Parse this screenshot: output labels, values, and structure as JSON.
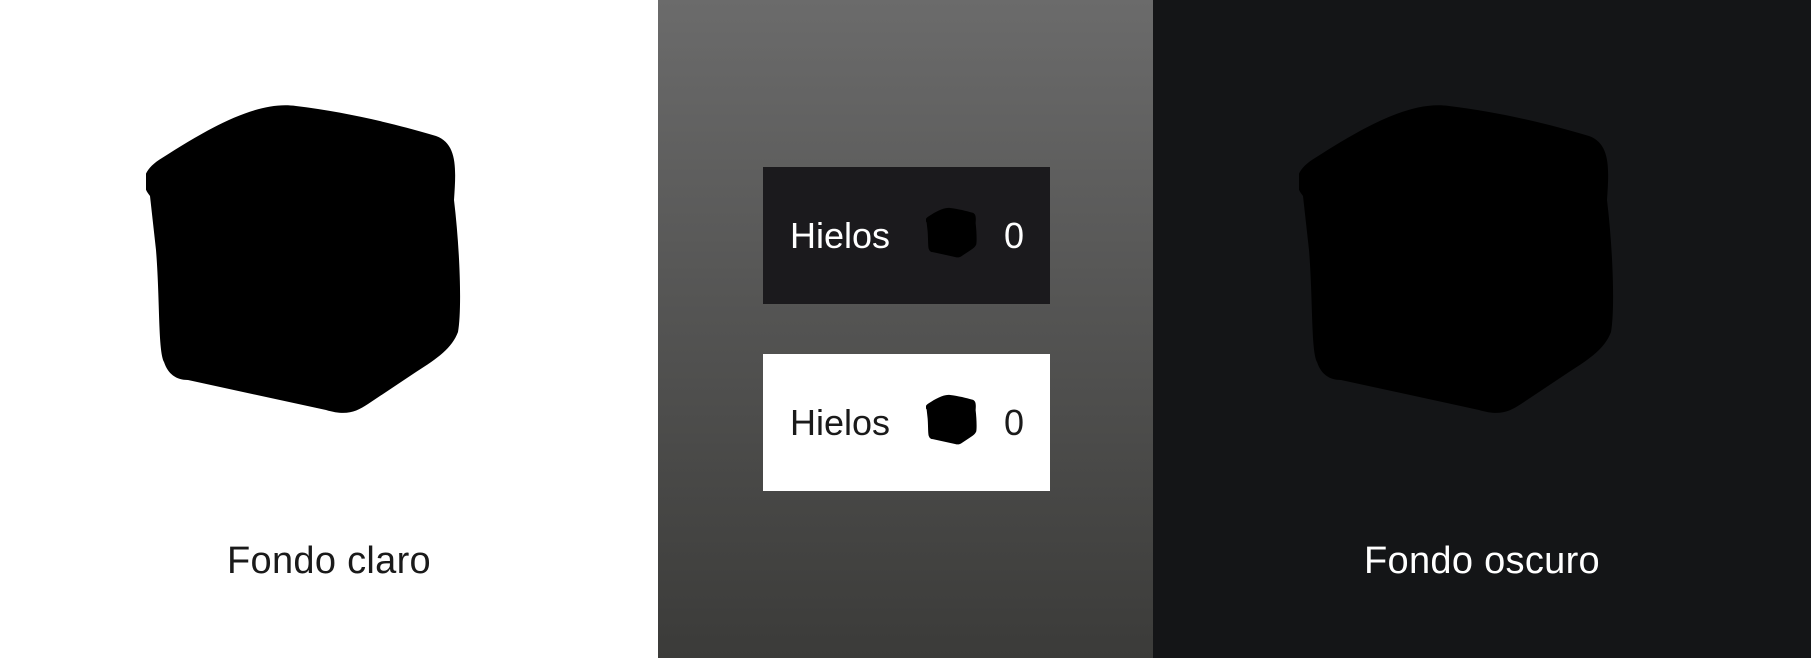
{
  "colors": {
    "ice_accent": "#35bcd4",
    "ice_fill_light": "#eef7fb",
    "ice_fill_dark": "#1c2024",
    "panel_light_bg": "#ffffff",
    "panel_dark_bg": "#141517",
    "panel_mid_gradient": [
      "#6b6b6b",
      "#3b3b39"
    ]
  },
  "light_panel": {
    "caption": "Fondo claro",
    "icon": "ice-cube-icon"
  },
  "middle_panel": {
    "badges": [
      {
        "theme": "dark",
        "label": "Hielos",
        "count": "0",
        "icon": "ice-cube-icon"
      },
      {
        "theme": "light",
        "label": "Hielos",
        "count": "0",
        "icon": "ice-cube-icon"
      }
    ]
  },
  "dark_panel": {
    "caption": "Fondo oscuro",
    "icon": "ice-cube-icon"
  }
}
